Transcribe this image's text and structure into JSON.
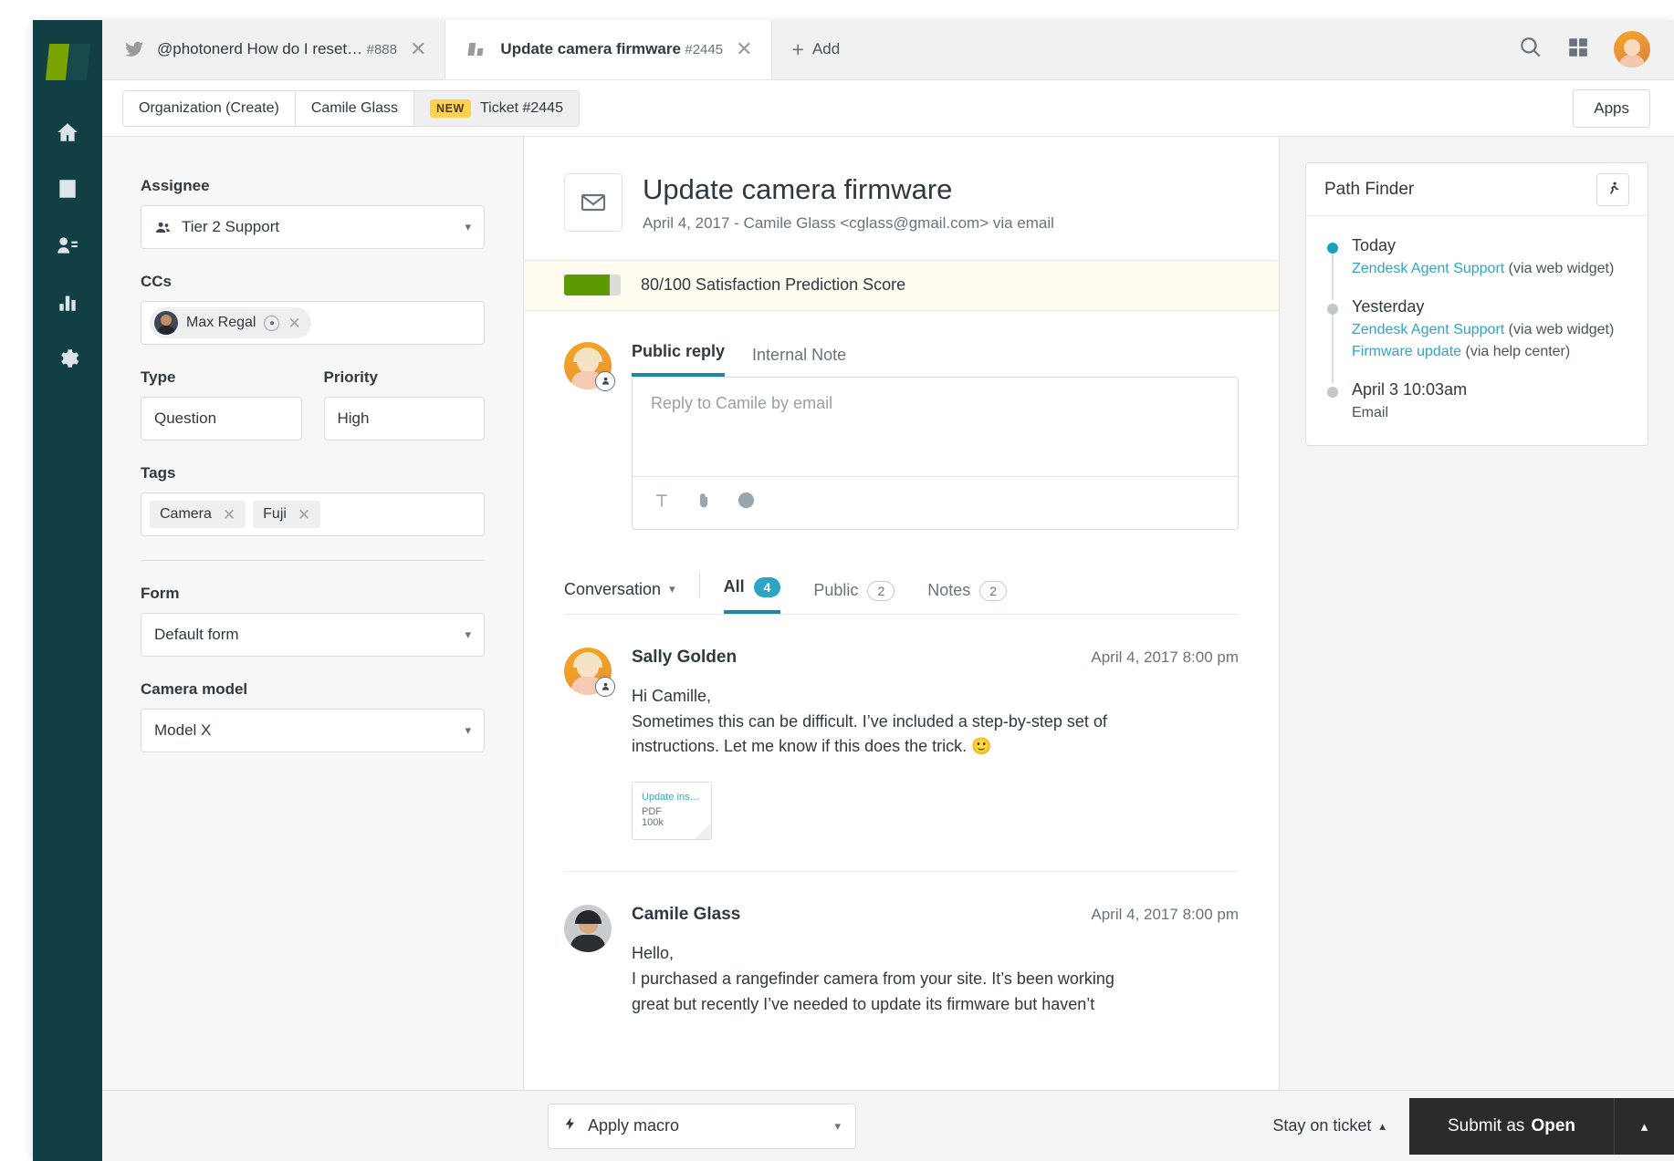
{
  "rail": {
    "logo_name": "zendesk-logo",
    "items": [
      {
        "name": "home",
        "label": "Home"
      },
      {
        "name": "views",
        "label": "Views"
      },
      {
        "name": "customers",
        "label": "Customers"
      },
      {
        "name": "reporting",
        "label": "Reporting"
      },
      {
        "name": "admin",
        "label": "Admin"
      }
    ]
  },
  "tabs": [
    {
      "title": "@photonerd How do I reset…",
      "number": "#888",
      "icon": "twitter-icon",
      "active": false
    },
    {
      "title": "Update camera firmware",
      "number": "#2445",
      "icon": "zendesk-icon",
      "active": true
    }
  ],
  "add_tab_label": "Add",
  "breadcrumb": {
    "items": [
      {
        "label": "Organization (Create)",
        "badge": ""
      },
      {
        "label": "Camile Glass",
        "badge": ""
      },
      {
        "label": "Ticket #2445",
        "badge": "NEW"
      }
    ]
  },
  "apps_button_label": "Apps",
  "properties": {
    "assignee": {
      "label": "Assignee",
      "value": "Tier 2 Support"
    },
    "ccs": {
      "label": "CCs",
      "value": "Max Regal"
    },
    "type": {
      "label": "Type",
      "value": "Question"
    },
    "priority": {
      "label": "Priority",
      "value": "High"
    },
    "tags": {
      "label": "Tags",
      "values": [
        "Camera",
        "Fuji"
      ]
    },
    "form": {
      "label": "Form",
      "value": "Default form"
    },
    "camera_model": {
      "label": "Camera model",
      "value": "Model X"
    }
  },
  "ticket": {
    "title": "Update camera firmware",
    "subtitle": "April 4, 2017 - Camile Glass <cglass@gmail.com> via email",
    "satisfaction": {
      "text": "80/100 Satisfaction Prediction Score",
      "score": 80,
      "max": 100,
      "bar_color": "#5B9A00"
    }
  },
  "composer": {
    "tabs": [
      {
        "label": "Public reply",
        "active": true
      },
      {
        "label": "Internal Note",
        "active": false
      }
    ],
    "placeholder": "Reply to Camile by email",
    "tools": [
      "text-format-icon",
      "attachment-icon",
      "emoji-icon"
    ]
  },
  "conversation": {
    "select_label": "Conversation",
    "filters": [
      {
        "label": "All",
        "count": "4",
        "active": true
      },
      {
        "label": "Public",
        "count": "2",
        "active": false
      },
      {
        "label": "Notes",
        "count": "2",
        "active": false
      }
    ],
    "messages": [
      {
        "author": "Sally Golden",
        "time": "April 4, 2017 8:00 pm",
        "lines": [
          "Hi Camille,",
          "Sometimes this can be difficult. I’ve included a step-by-step set of",
          "instructions. Let me know if this does the trick. 🙂"
        ],
        "attachment": {
          "name": "Update instruc…",
          "type": "PDF",
          "size": "100k"
        }
      },
      {
        "author": "Camile Glass",
        "time": "April 4, 2017 8:00 pm",
        "lines": [
          "Hello,",
          "I purchased a rangefinder camera from your site. It’s been working",
          "great but recently I’ve needed to update its firmware but haven’t"
        ],
        "attachment": null
      }
    ]
  },
  "path_finder": {
    "title": "Path Finder",
    "entries": [
      {
        "date": "Today",
        "current": true,
        "links": [
          {
            "text": "Zendesk Agent Support",
            "via": " (via web widget)"
          }
        ],
        "plain": ""
      },
      {
        "date": "Yesterday",
        "current": false,
        "links": [
          {
            "text": "Zendesk Agent Support",
            "via": " (via web widget)"
          },
          {
            "text": "Firmware update",
            "via": " (via help center)"
          }
        ],
        "plain": ""
      },
      {
        "date": "April 3 10:03am",
        "current": false,
        "links": [],
        "plain": "Email"
      }
    ]
  },
  "footer": {
    "macro_label": "Apply macro",
    "stay_label": "Stay on ticket",
    "submit_prefix": "Submit as",
    "submit_status": "Open"
  },
  "colors": {
    "rail_bg": "#123F45",
    "accent_teal": "#1F86A0",
    "badge_teal": "#2DA5C4",
    "link_teal": "#2DA5C4",
    "new_badge": "#FFD24D",
    "satisfaction_green": "#5B9A00",
    "submit_bg": "#2B2B2B"
  }
}
